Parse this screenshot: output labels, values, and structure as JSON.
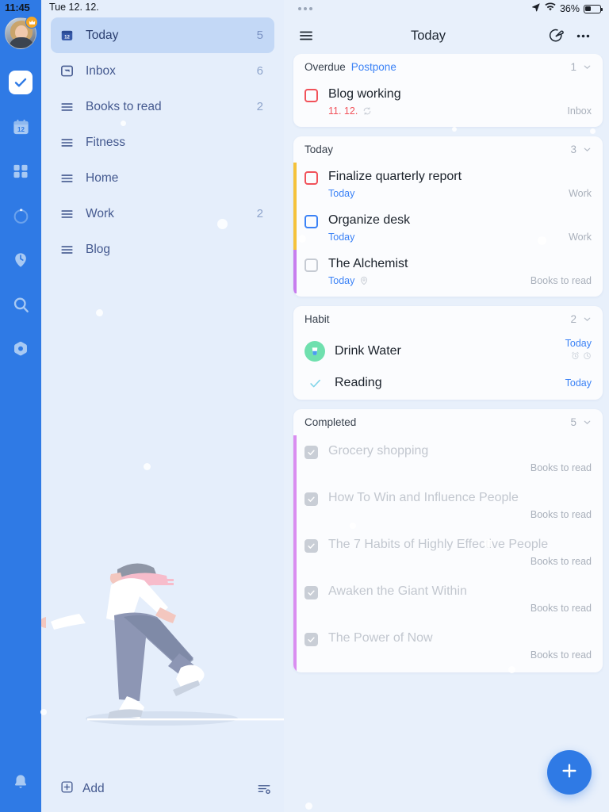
{
  "status_bar": {
    "time": "11:45",
    "date": "Tue 12. 12.",
    "battery_percent": "36%",
    "location_icon": "location-arrow-icon",
    "wifi_icon": "wifi-icon",
    "battery_icon": "battery-icon",
    "window_dots_icon": "window-dots-icon"
  },
  "rail": {
    "avatar_name": "user-avatar",
    "badge_icon": "crown-badge-icon",
    "items": [
      {
        "name": "tasks",
        "icon": "check-square-icon",
        "active": true
      },
      {
        "name": "calendar",
        "icon": "calendar-12-icon",
        "active": false
      },
      {
        "name": "matrix",
        "icon": "four-squares-icon",
        "active": false
      },
      {
        "name": "pomodoro",
        "icon": "timer-ring-icon",
        "active": false
      },
      {
        "name": "history",
        "icon": "clock-pin-icon",
        "active": false
      },
      {
        "name": "search",
        "icon": "search-icon",
        "active": false
      },
      {
        "name": "settings",
        "icon": "gear-icon",
        "active": false
      }
    ],
    "bottom_item": {
      "name": "notifications",
      "icon": "bell-icon"
    }
  },
  "sidebar": {
    "items": [
      {
        "label": "Today",
        "count": "5",
        "icon": "calendar-12-icon",
        "selected": true
      },
      {
        "label": "Inbox",
        "count": "6",
        "icon": "inbox-icon",
        "selected": false
      },
      {
        "label": "Books to read",
        "count": "2",
        "icon": "list-lines-icon",
        "selected": false
      },
      {
        "label": "Fitness",
        "count": "",
        "icon": "list-lines-icon",
        "selected": false
      },
      {
        "label": "Home",
        "count": "",
        "icon": "list-lines-icon",
        "selected": false
      },
      {
        "label": "Work",
        "count": "2",
        "icon": "list-lines-icon",
        "selected": false
      },
      {
        "label": "Blog",
        "count": "",
        "icon": "list-lines-icon",
        "selected": false
      }
    ],
    "illustration": "ice-skater-illustration",
    "add_label": "Add",
    "add_icon": "plus-square-icon",
    "sort_icon": "sort-settings-icon"
  },
  "topbar": {
    "menu_icon": "hamburger-menu-icon",
    "title": "Today",
    "focus_icon": "pomodoro-edit-icon",
    "more_icon": "more-horizontal-icon"
  },
  "sections": [
    {
      "title": "Overdue",
      "action": "Postpone",
      "count": "1",
      "chevron_icon": "chevron-down-icon",
      "tasks": [
        {
          "title": "Blog working",
          "date": "11. 12.",
          "date_overdue": true,
          "list": "Inbox",
          "checkbox": "red",
          "edge_color": "",
          "meta_icon": "repeat-icon"
        }
      ]
    },
    {
      "title": "Today",
      "action": "",
      "count": "3",
      "chevron_icon": "chevron-down-icon",
      "tasks": [
        {
          "title": "Finalize quarterly report",
          "date": "Today",
          "date_overdue": false,
          "list": "Work",
          "checkbox": "red",
          "edge_color": "#f5c23a",
          "meta_icon": ""
        },
        {
          "title": "Organize desk",
          "date": "Today",
          "date_overdue": false,
          "list": "Work",
          "checkbox": "blue",
          "edge_color": "#f5c23a",
          "meta_icon": ""
        },
        {
          "title": "The Alchemist",
          "date": "Today",
          "date_overdue": false,
          "list": "Books to read",
          "checkbox": "grey",
          "edge_color": "#c77dee",
          "meta_icon": "location-pin-icon"
        }
      ]
    },
    {
      "title": "Habit",
      "action": "",
      "count": "2",
      "chevron_icon": "chevron-down-icon",
      "habits": [
        {
          "title": "Drink Water",
          "date": "Today",
          "icon": "water-glass-icon",
          "icon_bg": "#6fe0ae",
          "done": false,
          "meta_icons": [
            "alarm-icon",
            "timer-icon"
          ]
        },
        {
          "title": "Reading",
          "date": "Today",
          "icon": "check-icon",
          "icon_bg": "",
          "done": true,
          "meta_icons": []
        }
      ]
    },
    {
      "title": "Completed",
      "action": "",
      "count": "5",
      "chevron_icon": "chevron-down-icon",
      "edge_color": "#d98df0",
      "tasks": [
        {
          "title": "Grocery shopping",
          "date": "",
          "list": "Books to read",
          "checkbox": "done",
          "completed": true
        },
        {
          "title": "How To Win and Influence People",
          "date": "",
          "list": "Books to read",
          "checkbox": "done",
          "completed": true
        },
        {
          "title": "The 7 Habits of Highly Effective People",
          "date": "",
          "list": "Books to read",
          "checkbox": "done",
          "completed": true
        },
        {
          "title": "Awaken the Giant Within",
          "date": "",
          "list": "Books to read",
          "checkbox": "done",
          "completed": true
        },
        {
          "title": "The Power of Now",
          "date": "",
          "list": "Books to read",
          "checkbox": "done",
          "completed": true
        }
      ]
    }
  ],
  "fab": {
    "icon": "plus-icon"
  },
  "colors": {
    "brand_blue": "#2f7ae5",
    "link_blue": "#3b82f6",
    "overdue_red": "#f1525a",
    "work_yellow": "#f5c23a",
    "books_purple": "#c77dee",
    "habit_green": "#6fe0ae"
  }
}
